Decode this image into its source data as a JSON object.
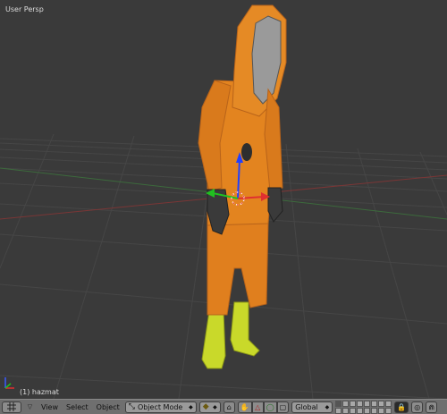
{
  "viewport": {
    "view_name": "User Persp",
    "object_name": "(1) hazmat",
    "colors": {
      "background": "#3a3a3a",
      "grid": "#454545",
      "x_axis": "#7a3636",
      "y_axis": "#3c6a3c",
      "suit": "#e07f1e",
      "boots": "#c9d92a",
      "gloves": "#3a3a3a",
      "visor": "#9a9a9a"
    }
  },
  "header": {
    "editor_icon": "grid-icon",
    "menus": [
      "View",
      "Select",
      "Object"
    ],
    "mode": "Object Mode",
    "orientation": "Global"
  }
}
